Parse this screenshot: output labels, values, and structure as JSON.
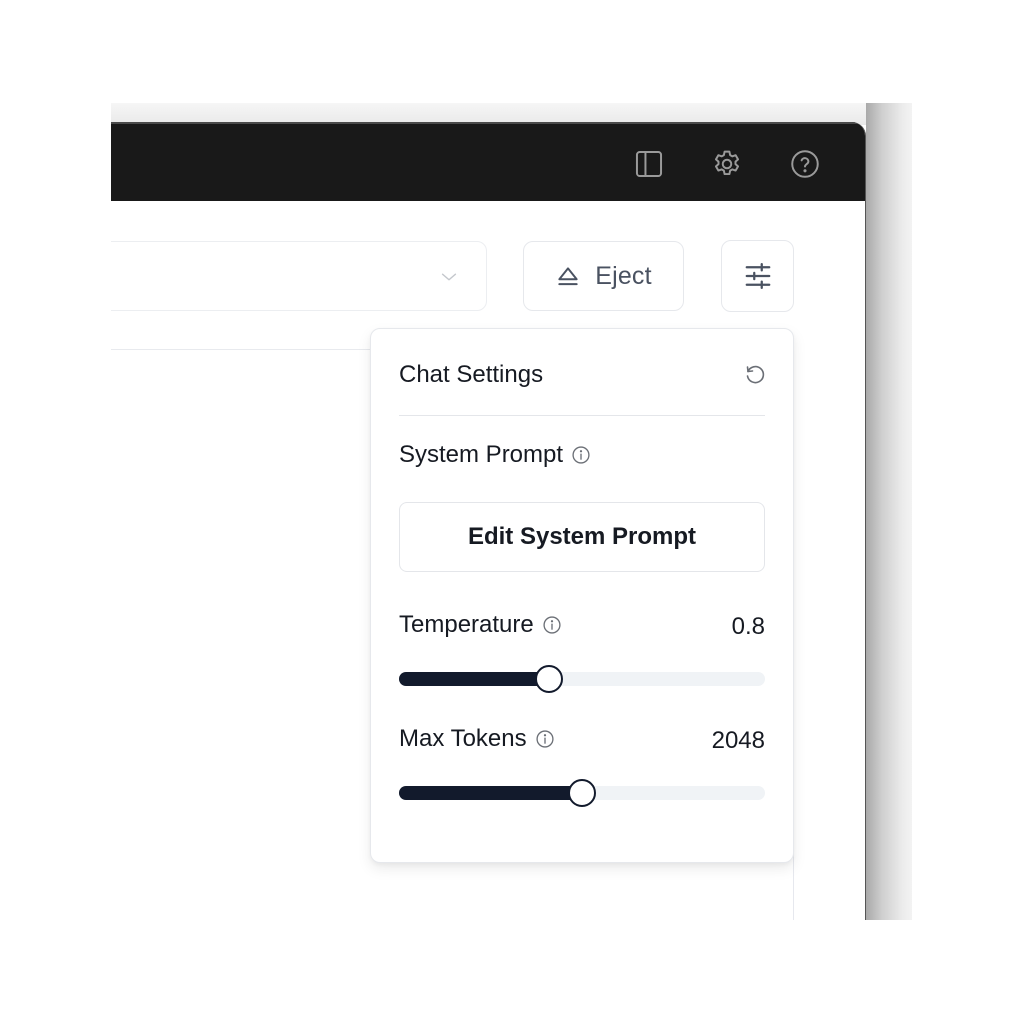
{
  "titlebar": {
    "icons": [
      {
        "name": "sidebar-toggle-icon"
      },
      {
        "name": "gear-icon"
      },
      {
        "name": "help-icon"
      }
    ]
  },
  "toolbar": {
    "model_select": {
      "value": "",
      "icon": "chevron-down-icon"
    },
    "eject_label": "Eject",
    "eject_icon": "eject-icon",
    "settings_icon": "sliders-icon"
  },
  "chat_settings": {
    "title": "Chat Settings",
    "reset_icon": "reset-icon",
    "system_prompt": {
      "label": "System Prompt",
      "info_icon": "info-icon",
      "button_label": "Edit System Prompt"
    },
    "temperature": {
      "label": "Temperature",
      "value_text": "0.8",
      "value": 0.8,
      "min": 0,
      "max": 2,
      "fraction": 0.41
    },
    "max_tokens": {
      "label": "Max Tokens",
      "value_text": "2048",
      "value": 2048,
      "min": 0,
      "max": 4096,
      "fraction": 0.5
    }
  },
  "colors": {
    "titlebar_bg": "#191919",
    "slider_fill": "#121a2c",
    "slider_track": "#f0f3f6",
    "text": "#161a22",
    "muted_text": "#4a5261"
  }
}
